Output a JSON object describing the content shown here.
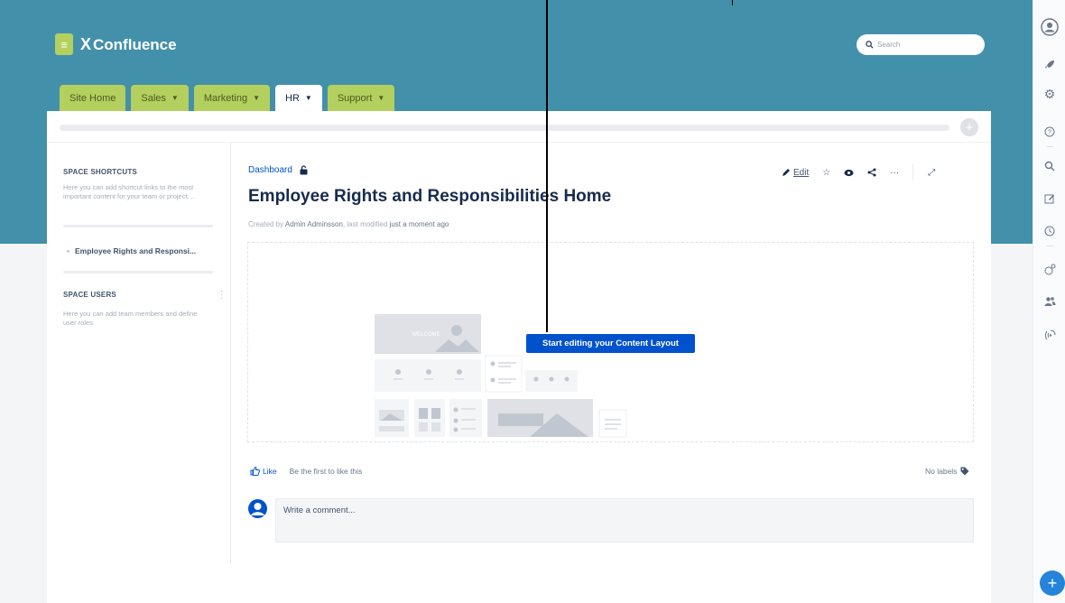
{
  "app": {
    "name": "Confluence",
    "logo_mark": "X"
  },
  "colors": {
    "header": "#4390ab",
    "tab": "#b3cf5e",
    "link": "#0052cc",
    "primary_button": "#0052cc"
  },
  "search": {
    "placeholder": "Search"
  },
  "tabs": [
    {
      "label": "Site Home",
      "dropdown": false
    },
    {
      "label": "Sales",
      "dropdown": true
    },
    {
      "label": "Marketing",
      "dropdown": true
    },
    {
      "label": "HR",
      "dropdown": true,
      "active": true
    },
    {
      "label": "Support",
      "dropdown": true
    }
  ],
  "sidebar": {
    "shortcuts_title": "SPACE SHORTCUTS",
    "shortcuts_desc": "Here you can add shortcut links to the most important content for your team or project. ..",
    "page_item": "Employee Rights and Responsi...",
    "users_title": "SPACE USERS",
    "users_desc": "Here you can add team members and define user roles."
  },
  "page": {
    "breadcrumb": "Dashboard",
    "title": "Employee Rights and Responsibilities Home",
    "byline_prefix": "Created by",
    "author": "Admin Adminsson",
    "byline_mid": ", last modified",
    "modified": "just a moment ago"
  },
  "actions": {
    "edit": "Edit"
  },
  "layout": {
    "button": "Start editing your Content Layout",
    "welcome_text": "WELCOME"
  },
  "footer": {
    "like": "Like",
    "like_hint": "Be the first to like this",
    "labels": "No labels",
    "comment_placeholder": "Write a comment..."
  },
  "rail_icons": [
    "user-icon",
    "rocket-icon",
    "settings-icon",
    "help-icon",
    "search-icon",
    "edit-icon",
    "history-icon",
    "integrations-icon",
    "people-icon",
    "stats-icon",
    "add-icon"
  ]
}
